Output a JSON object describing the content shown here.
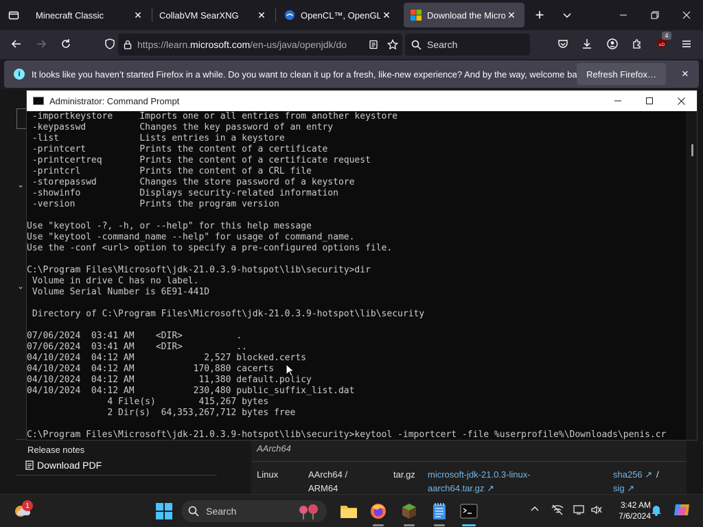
{
  "browser": {
    "tabs": [
      {
        "title": "Minecraft Classic",
        "active": false
      },
      {
        "title": "CollabVM SearXNG",
        "active": false
      },
      {
        "title": "OpenCL™, OpenGL®, ...",
        "active": false
      },
      {
        "title": "Download the Microso",
        "active": true
      }
    ],
    "new_tab": "+",
    "url_prefix": "https://learn.",
    "url_domain": "microsoft.com",
    "url_rest": "/en-us/java/openjdk/do",
    "search_placeholder": "Search",
    "extension_badge": "4",
    "notification": {
      "message": "It looks like you haven’t started Firefox in a while. Do you want to clean it up for a fresh, like-new experience? And by the way, welcome back!",
      "button": "Refresh Firefox…"
    }
  },
  "webpage": {
    "release_notes": "Release notes",
    "download_pdf": "Download PDF",
    "table": {
      "arch_italic": "AArch64",
      "os": "Linux",
      "arch_line1": "AArch64 /",
      "arch_line2": "ARM64",
      "type": "tar.gz",
      "file_line1": "microsoft-jdk-21.0.3-linux-",
      "file_line2": "aarch64.tar.gz",
      "sha": "sha256",
      "slash": "/",
      "sig": "sig"
    }
  },
  "cmd": {
    "title": "Administrator: Command Prompt",
    "lines": [
      " -importkeystore     Imports one or all entries from another keystore",
      " -keypasswd          Changes the key password of an entry",
      " -list               Lists entries in a keystore",
      " -printcert          Prints the content of a certificate",
      " -printcertreq       Prints the content of a certificate request",
      " -printcrl           Prints the content of a CRL file",
      " -storepasswd        Changes the store password of a keystore",
      " -showinfo           Displays security-related information",
      " -version            Prints the program version",
      "",
      "Use \"keytool -?, -h, or --help\" for this help message",
      "Use \"keytool -command_name --help\" for usage of command_name.",
      "Use the -conf <url> option to specify a pre-configured options file.",
      "",
      "C:\\Program Files\\Microsoft\\jdk-21.0.3.9-hotspot\\lib\\security>dir",
      " Volume in drive C has no label.",
      " Volume Serial Number is 6E91-441D",
      "",
      " Directory of C:\\Program Files\\Microsoft\\jdk-21.0.3.9-hotspot\\lib\\security",
      "",
      "07/06/2024  03:41 AM    <DIR>          .",
      "07/06/2024  03:41 AM    <DIR>          ..",
      "04/10/2024  04:12 AM             2,527 blocked.certs",
      "04/10/2024  04:12 AM           170,880 cacerts",
      "04/10/2024  04:12 AM            11,380 default.policy",
      "04/10/2024  04:12 AM           230,480 public_suffix_list.dat",
      "               4 File(s)        415,267 bytes",
      "               2 Dir(s)  64,353,267,712 bytes free",
      "",
      "C:\\Program Files\\Microsoft\\jdk-21.0.3.9-hotspot\\lib\\security>keytool -importcert -file %userprofile%\\Downloads\\penis.cr"
    ]
  },
  "taskbar": {
    "search_placeholder": "Search",
    "widgets_badge": "1",
    "time": "3:42 AM",
    "date": "7/6/2024"
  }
}
